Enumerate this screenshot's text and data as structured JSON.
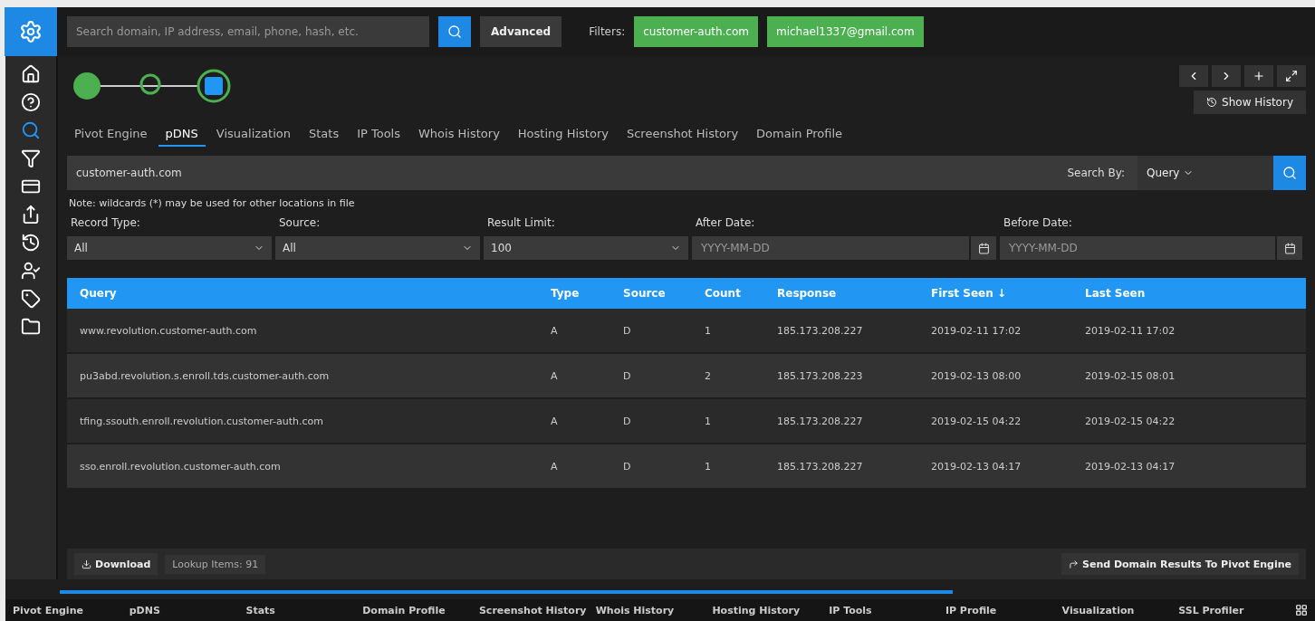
{
  "search": {
    "placeholder": "Search domain, IP address, email, phone, hash, etc.",
    "advanced": "Advanced"
  },
  "filters": {
    "label": "Filters:",
    "chips": [
      "customer-auth.com",
      "michael1337@gmail.com"
    ]
  },
  "history_button": "Show History",
  "tabs": [
    {
      "label": "Pivot Engine",
      "selected": false
    },
    {
      "label": "pDNS",
      "selected": true
    },
    {
      "label": "Visualization",
      "selected": false
    },
    {
      "label": "Stats",
      "selected": false
    },
    {
      "label": "IP Tools",
      "selected": false
    },
    {
      "label": "Whois History",
      "selected": false
    },
    {
      "label": "Hosting History",
      "selected": false
    },
    {
      "label": "Screenshot History",
      "selected": false
    },
    {
      "label": "Domain Profile",
      "selected": false
    }
  ],
  "query": {
    "value": "customer-auth.com",
    "search_by_label": "Search By:",
    "search_by": "Query"
  },
  "note": "Note: wildcards (*) may be used for other locations in file",
  "params": [
    {
      "label": "Record Type:",
      "value": "All",
      "kind": "select"
    },
    {
      "label": "Source:",
      "value": "All",
      "kind": "select"
    },
    {
      "label": "Result Limit:",
      "value": "100",
      "kind": "select"
    },
    {
      "label": "After Date:",
      "placeholder": "YYYY-MM-DD",
      "kind": "date"
    },
    {
      "label": "Before Date:",
      "placeholder": "YYYY-MM-DD",
      "kind": "date"
    }
  ],
  "table": {
    "columns": [
      "Query",
      "Type",
      "Source",
      "Count",
      "Response",
      "First Seen ↓",
      "Last Seen"
    ],
    "rows": [
      [
        "www.revolution.customer-auth.com",
        "A",
        "D",
        "1",
        "185.173.208.227",
        "2019-02-11 17:02",
        "2019-02-11 17:02"
      ],
      [
        "pu3abd.revolution.s.enroll.tds.customer-auth.com",
        "A",
        "D",
        "2",
        "185.173.208.223",
        "2019-02-13 08:00",
        "2019-02-15 08:01"
      ],
      [
        "tfing.ssouth.enroll.revolution.customer-auth.com",
        "A",
        "D",
        "1",
        "185.173.208.227",
        "2019-02-15 04:22",
        "2019-02-15 04:22"
      ],
      [
        "sso.enroll.revolution.customer-auth.com",
        "A",
        "D",
        "1",
        "185.173.208.227",
        "2019-02-13 04:17",
        "2019-02-13 04:17"
      ]
    ]
  },
  "footer": {
    "download": "Download",
    "count": "Lookup Items: 91",
    "send": "Send Domain Results To Pivot Engine"
  },
  "taskbar": [
    "Pivot Engine",
    "pDNS",
    "Stats",
    "Domain Profile",
    "Screenshot History",
    "Whois History",
    "Hosting History",
    "IP Tools",
    "IP Profile",
    "Visualization",
    "SSL Profiler"
  ]
}
